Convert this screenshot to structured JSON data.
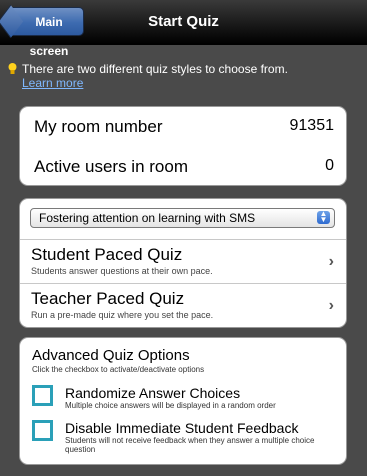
{
  "nav": {
    "back_label": "Main screen",
    "title": "Start Quiz"
  },
  "info": {
    "text": "There are two different quiz styles to choose from.",
    "link": "Learn more",
    "icon": "lightbulb-icon",
    "icon_color": "#ffd21e"
  },
  "room": {
    "number_label": "My room number",
    "number_value": "91351",
    "users_label": "Active users in room",
    "users_value": "0"
  },
  "quiz_select": {
    "selected": "Fostering attention on learning with SMS",
    "student_paced": {
      "title": "Student Paced Quiz",
      "subtitle": "Students answer questions at their own pace."
    },
    "teacher_paced": {
      "title": "Teacher Paced Quiz",
      "subtitle": "Run a pre-made quiz where you set the pace."
    }
  },
  "advanced": {
    "title": "Advanced Quiz Options",
    "subtitle": "Click the checkbox to activate/deactivate options",
    "options": [
      {
        "title": "Randomize Answer Choices",
        "subtitle": "Multiple choice answers will be displayed in a random order",
        "checked": false
      },
      {
        "title": "Disable Immediate Student Feedback",
        "subtitle": "Students will not receive feedback when they answer a multiple choice question",
        "checked": false
      }
    ]
  },
  "colors": {
    "background": "#4a4a4a",
    "checkbox": "#2aa0b8",
    "link": "#7fb8ff",
    "back_button": "#3d6bb0"
  }
}
